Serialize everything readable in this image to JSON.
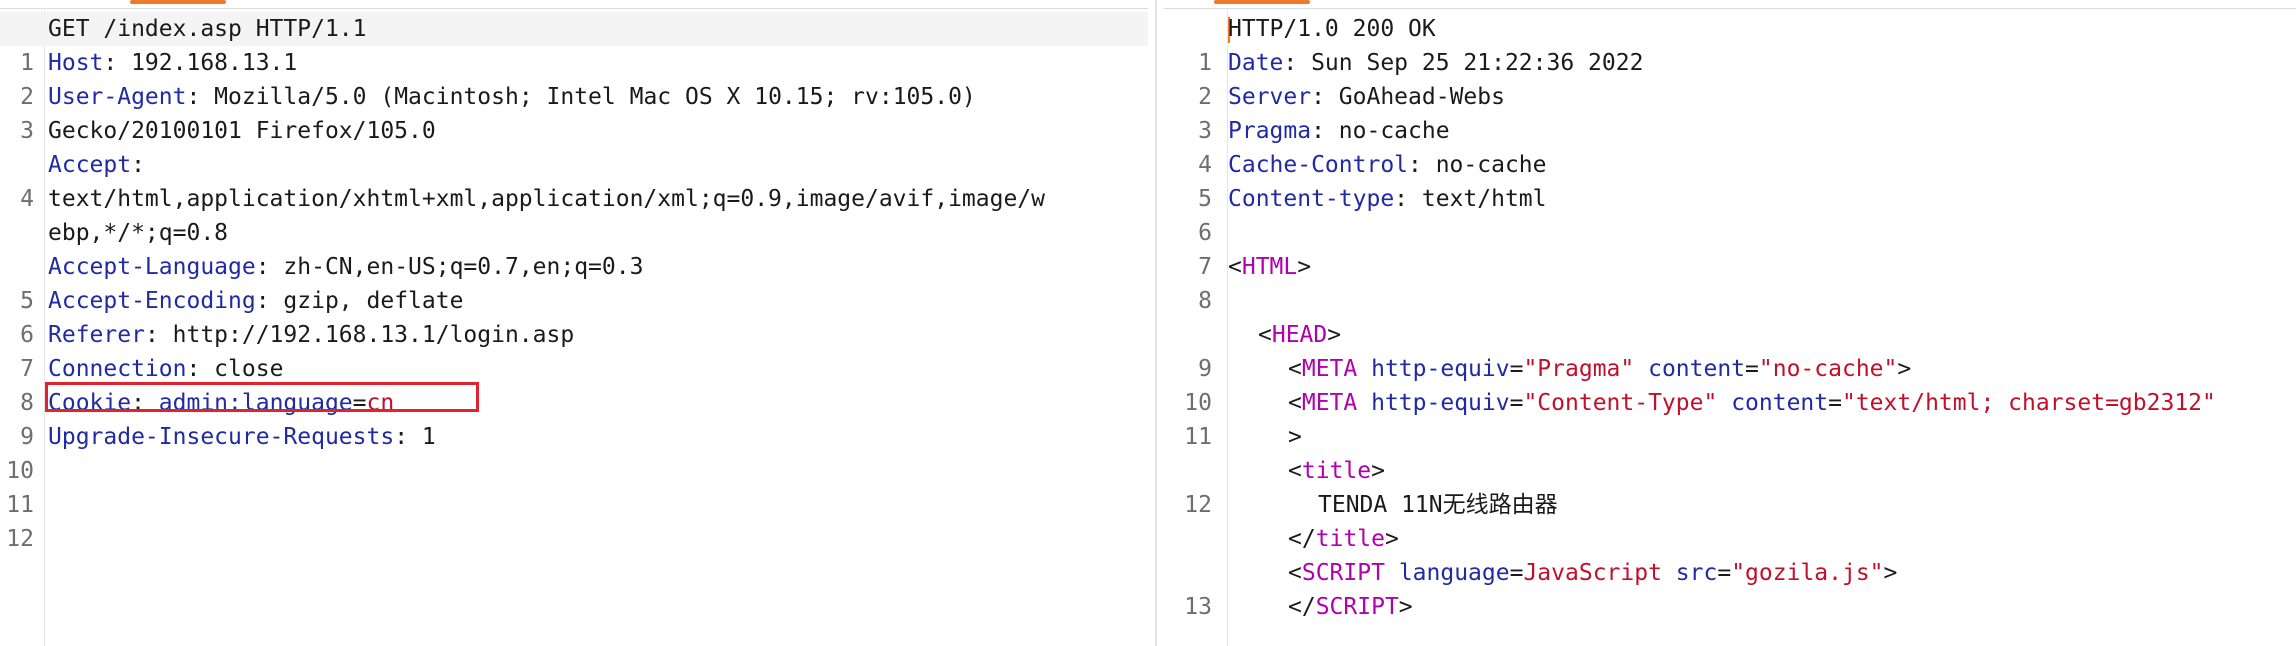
{
  "request": {
    "lines": [
      {
        "n": "1",
        "k": "",
        "s": "GET /index.asp HTTP/1.1",
        "v": ""
      },
      {
        "n": "2",
        "k": "Host",
        "s": ": 192.168.13.1",
        "v": ""
      },
      {
        "n": "3",
        "k": "User-Agent",
        "s": ": Mozilla/5.0 (Macintosh; Intel Mac OS X 10.15; rv:105.0)",
        "v": ""
      },
      {
        "n": "",
        "k": "",
        "s": "Gecko/20100101 Firefox/105.0",
        "v": ""
      },
      {
        "n": "4",
        "k": "Accept",
        "s": ":",
        "v": ""
      },
      {
        "n": "",
        "k": "",
        "s": "text/html,application/xhtml+xml,application/xml;q=0.9,image/avif,image/w",
        "v": ""
      },
      {
        "n": "",
        "k": "",
        "s": "ebp,*/*;q=0.8",
        "v": ""
      },
      {
        "n": "5",
        "k": "Accept-Language",
        "s": ": zh-CN,en-US;q=0.7,en;q=0.3",
        "v": ""
      },
      {
        "n": "6",
        "k": "Accept-Encoding",
        "s": ": gzip, deflate",
        "v": ""
      },
      {
        "n": "7",
        "k": "Referer",
        "s": ": http://192.168.13.1/login.asp",
        "v": ""
      },
      {
        "n": "8",
        "k": "Connection",
        "s": ": close",
        "v": ""
      },
      {
        "n": "9",
        "k": "Cookie",
        "s": ": ",
        "ck": "admin:language",
        "eq": "=",
        "v": "cn"
      },
      {
        "n": "10",
        "k": "Upgrade-Insecure-Requests",
        "s": ": 1",
        "v": ""
      },
      {
        "n": "11",
        "k": "",
        "s": "",
        "v": ""
      },
      {
        "n": "12",
        "k": "",
        "s": "",
        "v": ""
      }
    ]
  },
  "response": {
    "status": "HTTP/1.0 200 OK",
    "headers": [
      {
        "n": "2",
        "k": "Date",
        "s": ": Sun Sep 25 21:22:36 2022"
      },
      {
        "n": "3",
        "k": "Server",
        "s": ": GoAhead-Webs"
      },
      {
        "n": "4",
        "k": "Pragma",
        "s": ": no-cache"
      },
      {
        "n": "5",
        "k": "Cache-Control",
        "s": ": no-cache"
      },
      {
        "n": "6",
        "k": "Content-type",
        "s": ": text/html"
      }
    ],
    "line7": "7",
    "html": {
      "n": "8",
      "lt": "<",
      "tag": "HTML",
      "gt": ">"
    },
    "head": {
      "n": "9",
      "lt": "<",
      "tag": "HEAD",
      "gt": ">"
    },
    "meta1": {
      "n": "10",
      "lt": "<",
      "tag": "META",
      "a1": "http-equiv",
      "eq1": "=",
      "v1": "\"Pragma\"",
      "a2": "content",
      "eq2": "=",
      "v2": "\"no-cache\"",
      "gt": ">"
    },
    "meta2": {
      "n": "11",
      "lt": "<",
      "tag": "META",
      "a1": "http-equiv",
      "eq1": "=",
      "v1": "\"Content-Type\"",
      "a2": "content",
      "eq2": "=",
      "v2": "\"text/html; charset=gb2312\"",
      "gt": ">"
    },
    "title_open": {
      "n": "12",
      "lt": "<",
      "tag": "title",
      "gt": ">"
    },
    "title_text": "TENDA 11N无线路由器",
    "title_close": {
      "lt": "</",
      "tag": "title",
      "gt": ">"
    },
    "script_open": {
      "n": "13",
      "lt": "<",
      "tag": "SCRIPT",
      "a1": "language",
      "eq1": "=",
      "v1": "JavaScript",
      "a2": "src",
      "eq2": "=",
      "v2": "\"gozila.js\"",
      "gt": ">"
    },
    "script_close": {
      "lt": "</",
      "tag": "SCRIPT",
      "gt": ">"
    }
  },
  "colors": {
    "header_name": "#1f2aa3",
    "tag_name": "#b000b0",
    "string_value": "#c0102a",
    "highlight_border": "#e0242f",
    "accent": "#f07a2a"
  }
}
